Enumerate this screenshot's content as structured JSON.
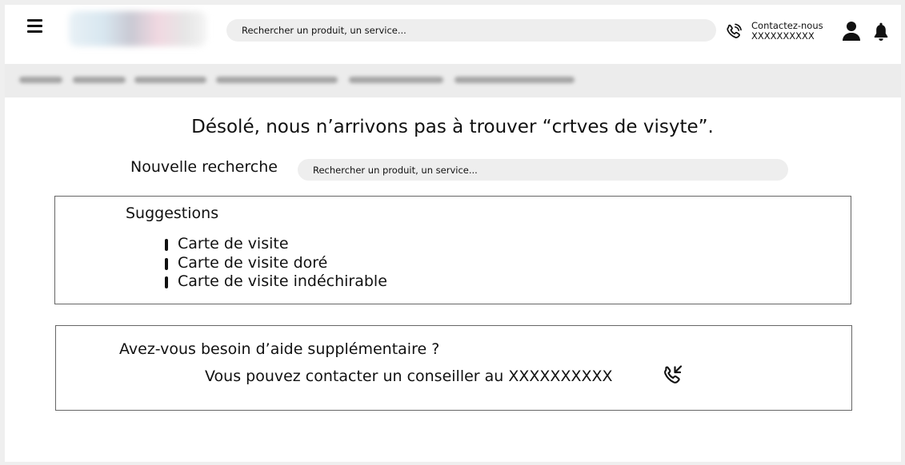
{
  "header": {
    "menu_icon": "hamburger-menu-icon",
    "search_placeholder": "Rechercher un produit, un service...",
    "contact": {
      "label": "Contactez-nous",
      "number": "XXXXXXXXXX",
      "icon": "phone-icon"
    },
    "user_icon": "user-icon",
    "notification_icon": "bell-icon"
  },
  "nav": {
    "items_blurred": 6
  },
  "main": {
    "heading": "Désolé, nous n’arrivons pas à trouver “crtves de visyte”.",
    "new_search": {
      "label": "Nouvelle recherche",
      "placeholder": "Rechercher un produit, un service..."
    },
    "suggestions": {
      "title": "Suggestions",
      "items": [
        "Carte de visite",
        "Carte de visite doré",
        "Carte de visite indéchirable"
      ]
    },
    "help": {
      "question": "Avez-vous besoin d’aide supplémentaire ?",
      "text": "Vous pouvez contacter un conseiller au XXXXXXXXXX",
      "icon": "incoming-call-icon"
    }
  }
}
